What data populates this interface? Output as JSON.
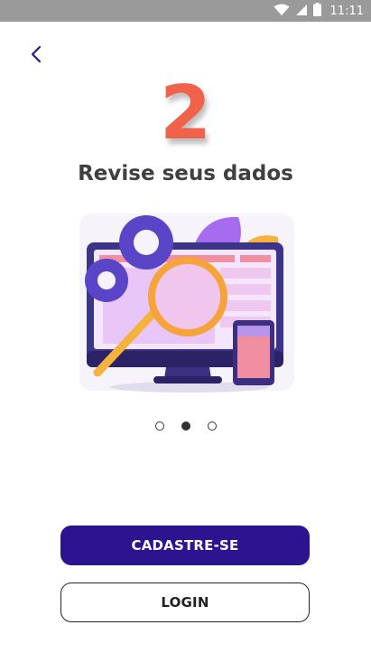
{
  "status_bar": {
    "time": "11:11",
    "icons": [
      "wifi-icon",
      "cellular-signal-icon",
      "battery-icon"
    ]
  },
  "header": {
    "back_icon": "chevron-left-icon"
  },
  "onboarding": {
    "step_number": "2",
    "title": "Revise seus dados",
    "illustration": "monitor-magnifier-gears-illustration",
    "pager": {
      "total": 3,
      "active_index": 1
    }
  },
  "actions": {
    "register_label": "CADASTRE-SE",
    "login_label": "LOGIN"
  },
  "colors": {
    "primary": "#2c1490",
    "accent_number": "#f0624a",
    "title_text": "#404040",
    "status_bar": "#9a9a9a"
  }
}
